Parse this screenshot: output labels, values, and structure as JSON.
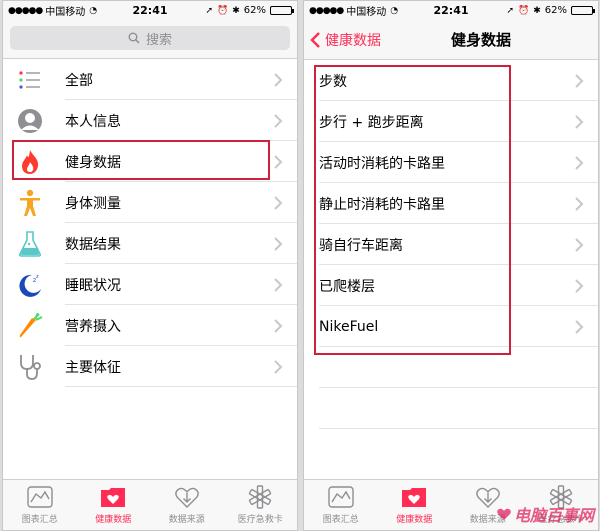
{
  "status": {
    "carrier": "中国移动",
    "time": "22:41",
    "battery": "62%",
    "battery_level": 0.62
  },
  "left": {
    "search_placeholder": "搜索",
    "items": [
      {
        "label": "全部",
        "icon": "list-icon"
      },
      {
        "label": "本人信息",
        "icon": "person-icon"
      },
      {
        "label": "健身数据",
        "icon": "flame-icon",
        "color": "#ff3b30"
      },
      {
        "label": "身体测量",
        "icon": "body-figure-icon",
        "color": "#f5a623"
      },
      {
        "label": "数据结果",
        "icon": "flask-icon",
        "color": "#5ac8c8"
      },
      {
        "label": "睡眠状况",
        "icon": "moon-icon",
        "color": "#1c49b8"
      },
      {
        "label": "营养摄入",
        "icon": "carrot-icon",
        "color": "#ff8a00"
      },
      {
        "label": "主要体征",
        "icon": "stethoscope-icon"
      }
    ]
  },
  "right": {
    "back_label": "健康数据",
    "title": "健身数据",
    "items": [
      {
        "label": "步数"
      },
      {
        "label": "步行 + 跑步距离"
      },
      {
        "label": "活动时消耗的卡路里"
      },
      {
        "label": "静止时消耗的卡路里"
      },
      {
        "label": "骑自行车距离"
      },
      {
        "label": "已爬楼层"
      },
      {
        "label": "NikeFuel"
      }
    ]
  },
  "tabs": [
    {
      "label": "图表汇总",
      "icon": "chart-icon"
    },
    {
      "label": "健康数据",
      "icon": "health-folder-icon",
      "active": true
    },
    {
      "label": "数据来源",
      "icon": "download-heart-icon"
    },
    {
      "label": "医疗急救卡",
      "icon": "asterisk-icon"
    }
  ],
  "accent_color": "#ff2d55",
  "highlight_color": "#d0213a",
  "watermark": "电脑百事网"
}
